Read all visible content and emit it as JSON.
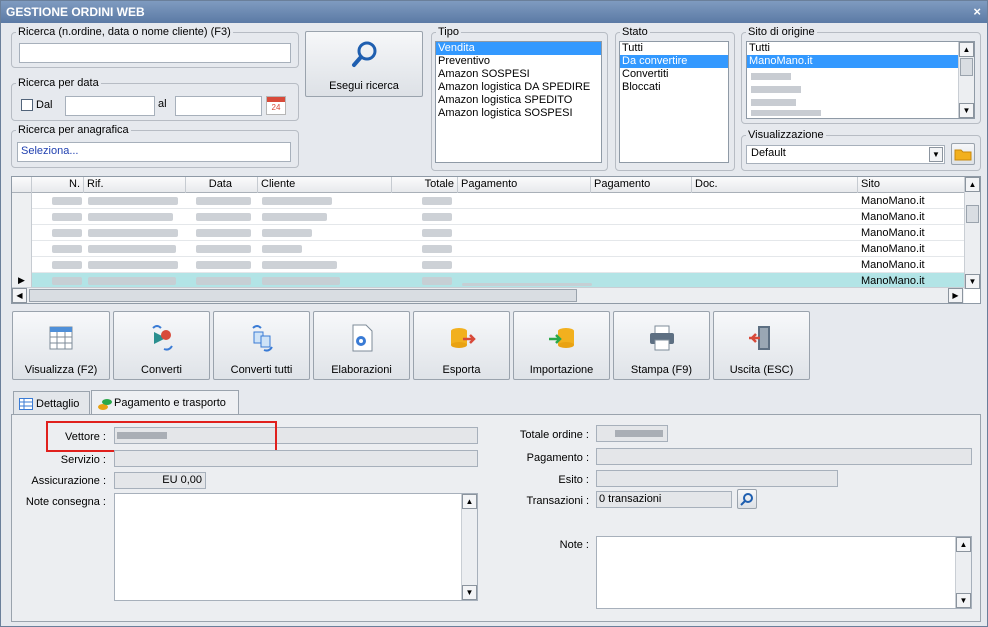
{
  "window": {
    "title": "GESTIONE ORDINI WEB",
    "close_label": "×"
  },
  "search": {
    "legend": "Ricerca (n.ordine, data o nome cliente) (F3)",
    "value": "",
    "run_label": "Esegui ricerca"
  },
  "date_search": {
    "legend": "Ricerca per data",
    "from_label": "Dal",
    "to_label": "al",
    "from_value": "",
    "to_value": "",
    "calendar_label": "24"
  },
  "registry_search": {
    "legend": "Ricerca per anagrafica",
    "placeholder": "Seleziona..."
  },
  "tipo": {
    "legend": "Tipo",
    "items": [
      "Vendita",
      "Preventivo",
      "Amazon SOSPESI",
      "Amazon logistica DA SPEDIRE",
      "Amazon logistica SPEDITO",
      "Amazon logistica SOSPESI"
    ],
    "selected": 0
  },
  "stato": {
    "legend": "Stato",
    "items": [
      "Tutti",
      "Da convertire",
      "Convertiti",
      "Bloccati"
    ],
    "selected": 1
  },
  "sito": {
    "legend": "Sito di origine",
    "items": [
      "Tutti",
      "ManoMano.it"
    ],
    "selected": 1
  },
  "visualizzazione": {
    "legend": "Visualizzazione",
    "value": "Default"
  },
  "grid": {
    "columns": [
      "N.",
      "Rif.",
      "Data",
      "Cliente",
      "Totale",
      "Pagamento",
      "Pagamento",
      "Doc.",
      "Sito"
    ],
    "rows": [
      {
        "sito": "ManoMano.it"
      },
      {
        "sito": "ManoMano.it"
      },
      {
        "sito": "ManoMano.it"
      },
      {
        "sito": "ManoMano.it"
      },
      {
        "sito": "ManoMano.it"
      },
      {
        "sito": "ManoMano.it"
      }
    ],
    "selected_row": 5
  },
  "toolbar": {
    "visualizza": "Visualizza (F2)",
    "converti": "Converti",
    "converti_tutti": "Converti tutti",
    "elaborazioni": "Elaborazioni",
    "esporta": "Esporta",
    "importazione": "Importazione",
    "stampa": "Stampa (F9)",
    "uscita": "Uscita (ESC)"
  },
  "tabs": {
    "dettaglio": "Dettaglio",
    "pagamento": "Pagamento e trasporto"
  },
  "detail": {
    "vettore_label": "Vettore :",
    "servizio_label": "Servizio :",
    "assicurazione_label": "Assicurazione :",
    "assicurazione_value": "EU 0,00",
    "note_consegna_label": "Note consegna :",
    "totale_label": "Totale ordine :",
    "pagamento_label": "Pagamento :",
    "esito_label": "Esito :",
    "transazioni_label": "Transazioni :",
    "transazioni_value": "0 transazioni",
    "note_label": "Note :"
  },
  "colors": {
    "selection": "#3399ff",
    "row_selected": "#b2e4e6",
    "highlight_box": "#e0201d"
  }
}
